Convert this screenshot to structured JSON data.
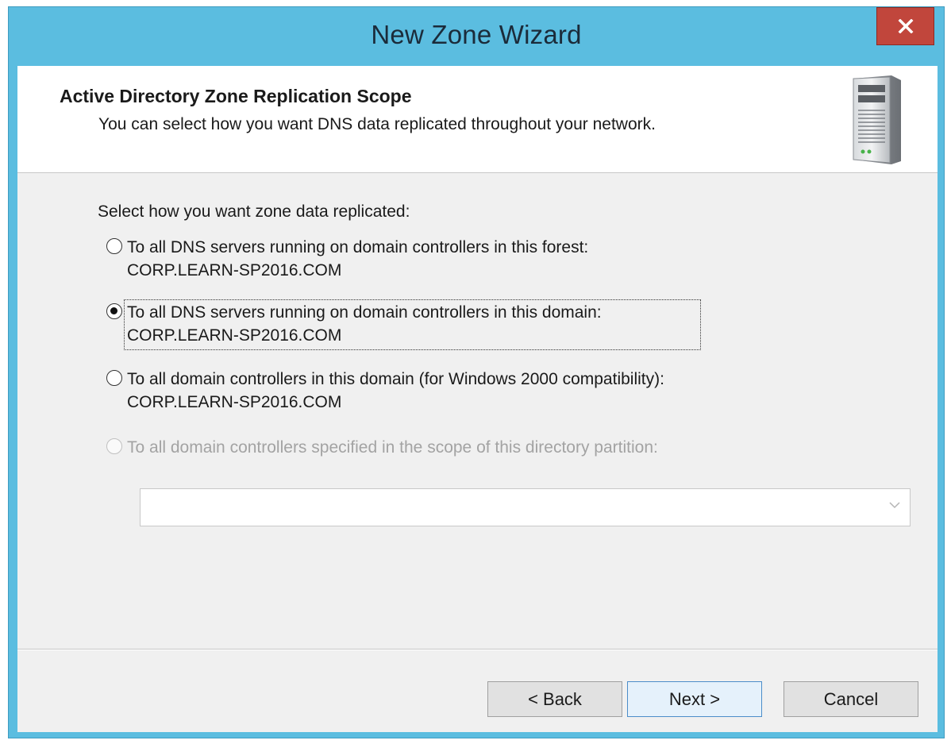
{
  "window": {
    "title": "New Zone Wizard",
    "close_label": "x"
  },
  "header": {
    "title": "Active Directory Zone Replication Scope",
    "subtitle": "You can select how you want DNS data replicated throughout your network.",
    "icon": "server-icon"
  },
  "body": {
    "prompt": "Select how you want zone data replicated:",
    "options": [
      {
        "line1": "To all DNS servers running on domain controllers in this forest:",
        "line2": "CORP.LEARN-SP2016.COM",
        "selected": false,
        "enabled": true
      },
      {
        "line1": "To all DNS servers running on domain controllers in this domain:",
        "line2": "CORP.LEARN-SP2016.COM",
        "selected": true,
        "enabled": true
      },
      {
        "line1": "To all domain controllers in this domain (for Windows 2000 compatibility):",
        "line2": "CORP.LEARN-SP2016.COM",
        "selected": false,
        "enabled": true
      },
      {
        "line1": "To all domain controllers specified in the scope of this directory partition:",
        "line2": "",
        "selected": false,
        "enabled": false
      }
    ],
    "partition_dropdown": {
      "value": "",
      "enabled": false
    }
  },
  "buttons": {
    "back": "< Back",
    "next": "Next >",
    "cancel": "Cancel"
  },
  "colors": {
    "titlebar": "#5bbde0",
    "close": "#c1463c",
    "client": "#f0f0f0"
  }
}
